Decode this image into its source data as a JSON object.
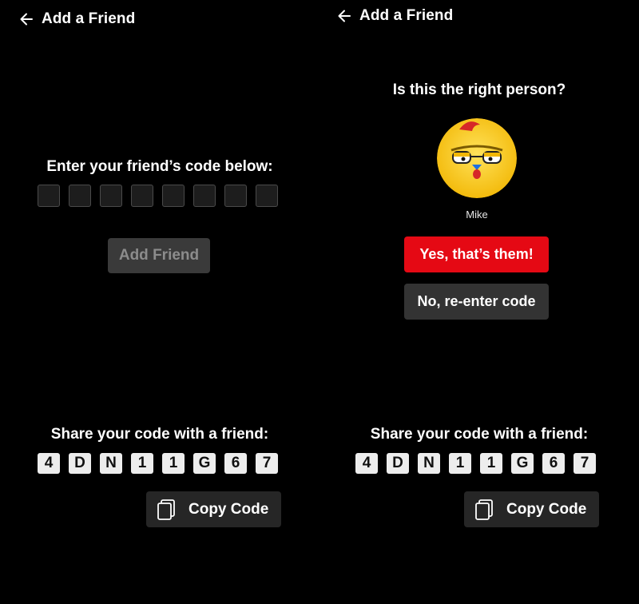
{
  "left_screen": {
    "header": {
      "title": "Add a Friend",
      "back_icon": "arrow-left-icon"
    },
    "enter_prompt": "Enter your friend’s code below:",
    "code_input_boxes": [
      "",
      "",
      "",
      "",
      "",
      "",
      "",
      ""
    ],
    "add_friend_label": "Add Friend",
    "share_prompt": "Share your code with a friend:",
    "my_code": [
      "4",
      "D",
      "N",
      "1",
      "1",
      "G",
      "6",
      "7"
    ],
    "copy_code_label": "Copy Code",
    "copy_icon": "copy-icon"
  },
  "right_screen": {
    "header": {
      "title": "Add a Friend",
      "back_icon": "arrow-left-icon"
    },
    "confirm_question": "Is this the right person?",
    "profile": {
      "name": "Mike",
      "avatar_icon": "chicken-avatar"
    },
    "yes_label": "Yes, that’s them!",
    "no_label": "No, re-enter code",
    "share_prompt": "Share your code with a friend:",
    "my_code": [
      "4",
      "D",
      "N",
      "1",
      "1",
      "G",
      "6",
      "7"
    ],
    "copy_code_label": "Copy Code",
    "copy_icon": "copy-icon"
  },
  "colors": {
    "background": "#000000",
    "primary_red": "#e50914",
    "disabled_button": "#3a3a3a",
    "secondary_button": "#333333",
    "code_tile": "#ededed"
  }
}
